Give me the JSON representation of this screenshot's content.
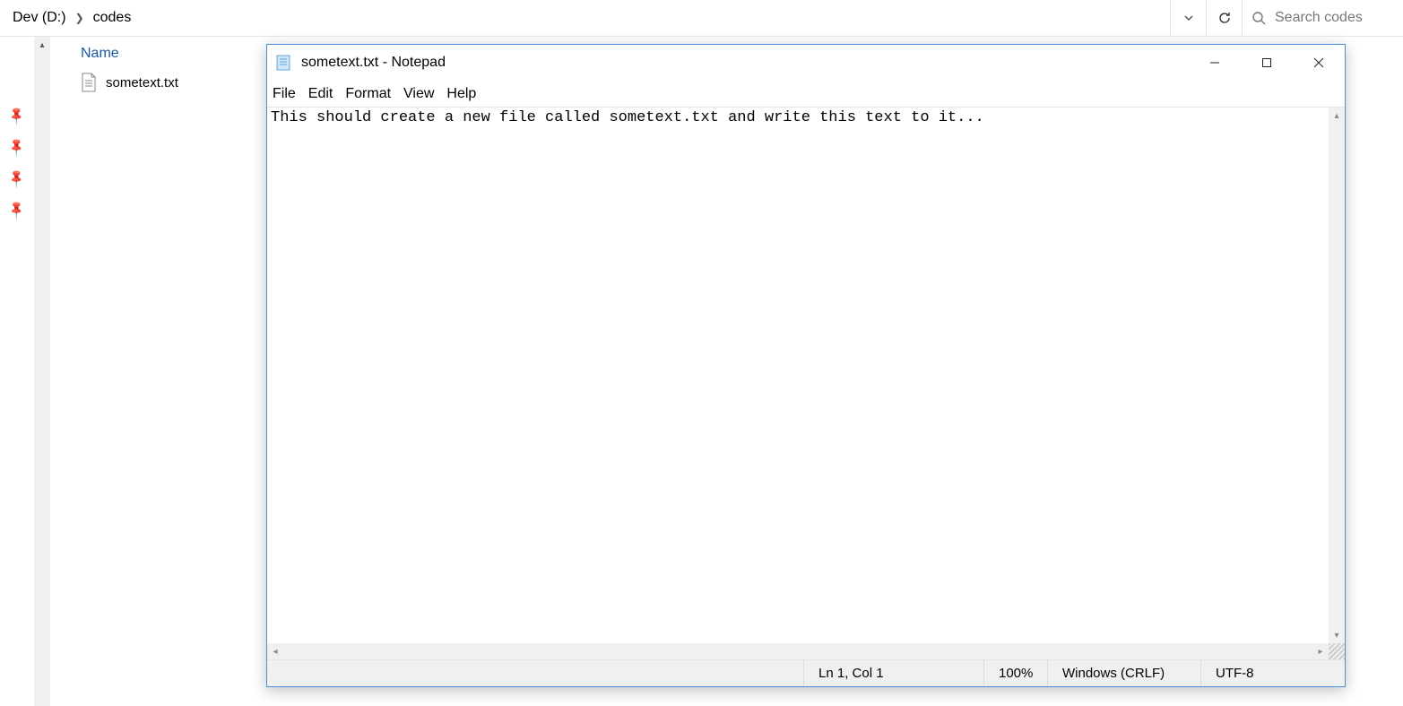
{
  "explorer": {
    "breadcrumb": [
      "Dev (D:)",
      "codes"
    ],
    "search_placeholder": "Search codes",
    "column_header": "Name",
    "files": [
      {
        "name": "sometext.txt"
      }
    ]
  },
  "notepad": {
    "title": "sometext.txt - Notepad",
    "menu": {
      "file": "File",
      "edit": "Edit",
      "format": "Format",
      "view": "View",
      "help": "Help"
    },
    "content": "This should create a new file called sometext.txt and write this text to it...",
    "status": {
      "position": "Ln 1, Col 1",
      "zoom": "100%",
      "line_ending": "Windows (CRLF)",
      "encoding": "UTF-8"
    }
  }
}
